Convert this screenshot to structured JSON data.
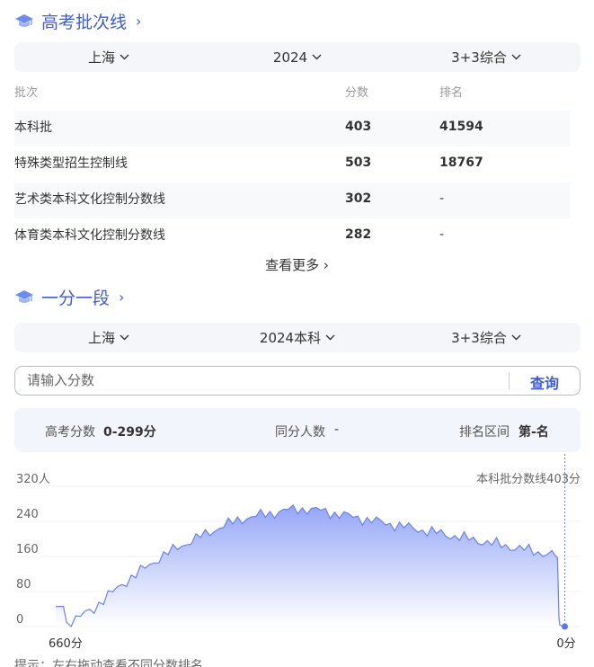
{
  "batch_section": {
    "title": "高考批次线",
    "filters": [
      "上海",
      "2024",
      "3+3综合"
    ],
    "columns": [
      "批次",
      "分数",
      "排名"
    ],
    "rows": [
      {
        "name": "本科批",
        "score": "403",
        "rank": "41594"
      },
      {
        "name": "特殊类型招生控制线",
        "score": "503",
        "rank": "18767"
      },
      {
        "name": "艺术类本科文化控制分数线",
        "score": "302",
        "rank": "-"
      },
      {
        "name": "体育类本科文化控制分数线",
        "score": "282",
        "rank": "-"
      }
    ],
    "more_label": "查看更多"
  },
  "segment_section": {
    "title": "一分一段",
    "filters": [
      "上海",
      "2024本科",
      "3+3综合"
    ],
    "search_placeholder": "请输入分数",
    "search_button": "查询",
    "stats": {
      "score_label": "高考分数",
      "score_value": "0-299分",
      "same_label": "同分人数",
      "same_value": "-",
      "rank_label": "排名区间",
      "rank_value": "第-名"
    },
    "tip": "提示：左右拖动查看不同分数排名"
  },
  "chart_data": {
    "type": "area",
    "ylabel_unit": "人",
    "y_ticks": [
      "320人",
      "240",
      "160",
      "80",
      "0"
    ],
    "ylim": [
      0,
      320
    ],
    "x_ticks": [
      "660分",
      "0分"
    ],
    "xlim": [
      660,
      0
    ],
    "marker_label": "本科批分数线403分",
    "marker_x": 403,
    "colors": {
      "line": "#6a82ee",
      "fill_top": "#8ea0f7",
      "fill_bottom": "#ffffff"
    },
    "series": [
      {
        "values": [
          [
            660,
            46
          ],
          [
            655,
            46
          ],
          [
            650,
            46
          ],
          [
            646,
            10
          ],
          [
            640,
            12
          ],
          [
            634,
            16
          ],
          [
            628,
            22
          ],
          [
            622,
            30
          ],
          [
            616,
            36
          ],
          [
            610,
            42
          ],
          [
            604,
            52
          ],
          [
            598,
            60
          ],
          [
            592,
            70
          ],
          [
            586,
            78
          ],
          [
            580,
            88
          ],
          [
            574,
            96
          ],
          [
            568,
            104
          ],
          [
            562,
            112
          ],
          [
            556,
            118
          ],
          [
            550,
            126
          ],
          [
            544,
            134
          ],
          [
            538,
            142
          ],
          [
            532,
            148
          ],
          [
            526,
            156
          ],
          [
            520,
            162
          ],
          [
            514,
            168
          ],
          [
            508,
            174
          ],
          [
            502,
            180
          ],
          [
            496,
            186
          ],
          [
            490,
            190
          ],
          [
            484,
            196
          ],
          [
            478,
            200
          ],
          [
            472,
            206
          ],
          [
            466,
            210
          ],
          [
            460,
            216
          ],
          [
            454,
            220
          ],
          [
            448,
            226
          ],
          [
            442,
            230
          ],
          [
            436,
            234
          ],
          [
            430,
            238
          ],
          [
            424,
            242
          ],
          [
            418,
            246
          ],
          [
            412,
            248
          ],
          [
            406,
            250
          ],
          [
            400,
            252
          ],
          [
            394,
            254
          ],
          [
            388,
            256
          ],
          [
            382,
            258
          ],
          [
            376,
            260
          ],
          [
            370,
            262
          ],
          [
            364,
            264
          ],
          [
            358,
            266
          ],
          [
            352,
            266
          ],
          [
            346,
            268
          ],
          [
            340,
            268
          ],
          [
            334,
            268
          ],
          [
            328,
            266
          ],
          [
            322,
            266
          ],
          [
            316,
            264
          ],
          [
            310,
            262
          ],
          [
            304,
            260
          ],
          [
            298,
            258
          ],
          [
            292,
            256
          ],
          [
            286,
            254
          ],
          [
            280,
            252
          ],
          [
            274,
            250
          ],
          [
            268,
            248
          ],
          [
            262,
            246
          ],
          [
            256,
            244
          ],
          [
            250,
            242
          ],
          [
            244,
            240
          ],
          [
            238,
            238
          ],
          [
            232,
            236
          ],
          [
            226,
            234
          ],
          [
            220,
            232
          ],
          [
            214,
            230
          ],
          [
            208,
            228
          ],
          [
            202,
            226
          ],
          [
            196,
            224
          ],
          [
            190,
            222
          ],
          [
            184,
            220
          ],
          [
            178,
            218
          ],
          [
            172,
            216
          ],
          [
            166,
            214
          ],
          [
            160,
            212
          ],
          [
            154,
            210
          ],
          [
            148,
            208
          ],
          [
            142,
            206
          ],
          [
            136,
            204
          ],
          [
            130,
            202
          ],
          [
            124,
            200
          ],
          [
            118,
            198
          ],
          [
            112,
            196
          ],
          [
            106,
            194
          ],
          [
            100,
            192
          ],
          [
            94,
            190
          ],
          [
            88,
            188
          ],
          [
            82,
            186
          ],
          [
            76,
            184
          ],
          [
            70,
            182
          ],
          [
            64,
            180
          ],
          [
            58,
            178
          ],
          [
            52,
            176
          ],
          [
            46,
            174
          ],
          [
            40,
            172
          ],
          [
            34,
            170
          ],
          [
            28,
            168
          ],
          [
            22,
            166
          ],
          [
            16,
            164
          ],
          [
            12,
            162
          ],
          [
            9,
            158
          ],
          [
            8,
            100
          ],
          [
            7,
            20
          ],
          [
            6,
            4
          ],
          [
            4,
            2
          ],
          [
            2,
            2
          ],
          [
            0,
            2
          ]
        ]
      }
    ]
  }
}
